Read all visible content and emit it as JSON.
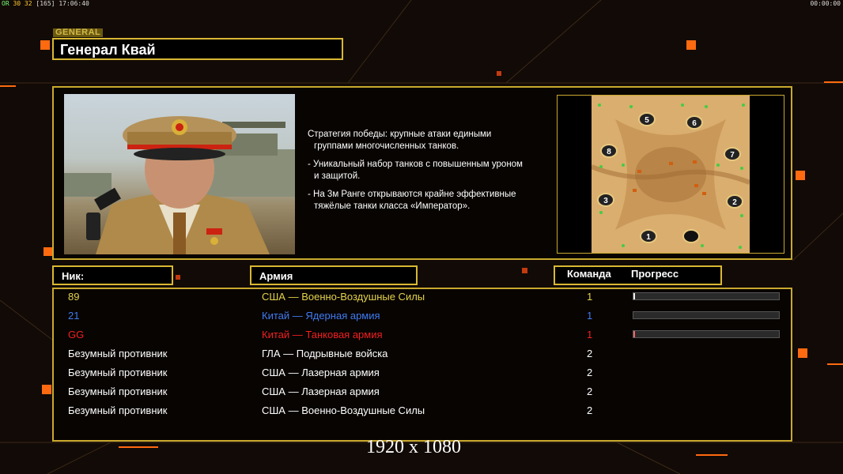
{
  "topbar": {
    "fps_label": "ОR",
    "fps_values": "30 32",
    "fps_extra": "[165]",
    "clock": "17:06:40",
    "timer": "00:00:00"
  },
  "general": {
    "tag": "GENERAL",
    "name": "Генерал Квай"
  },
  "strategy": {
    "lines": [
      [
        "Стратегия победы: крупные атаки едиными",
        " группами многочисленных танков."
      ],
      [
        "- Уникальный набор танков с повышенным уроном",
        "  и защитой."
      ],
      [
        "- На 3м Ранге открываются крайне эффективные",
        "  тяжёлые танки класса «Император»."
      ]
    ]
  },
  "map": {
    "start_positions": [
      "5",
      "6",
      "8",
      "7",
      "3",
      "2",
      "1"
    ]
  },
  "columns": {
    "nick": "Ник:",
    "army": "Армия",
    "team": "Команда",
    "progress": "Прогресс"
  },
  "players": [
    {
      "nick": "89",
      "army": "США — Военно-Воздушные Силы",
      "team": "1",
      "color": "#e3d24a",
      "progress": 0.01
    },
    {
      "nick": "21",
      "army": "Китай — Ядерная армия",
      "team": "1",
      "color": "#3f7bf0",
      "progress": 0.0
    },
    {
      "nick": "GG",
      "army": "Китай — Танковая армия",
      "team": "1",
      "color": "#f02020",
      "progress": 0.01
    },
    {
      "nick": "Безумный противник",
      "army": "ГЛА — Подрывные войска",
      "team": "2",
      "color": "#ffffff"
    },
    {
      "nick": "Безумный противник",
      "army": "США — Лазерная армия",
      "team": "2",
      "color": "#ffffff"
    },
    {
      "nick": "Безумный противник",
      "army": "США — Лазерная армия",
      "team": "2",
      "color": "#ffffff"
    },
    {
      "nick": "Безумный противник",
      "army": "США — Военно-Воздушные Силы",
      "team": "2",
      "color": "#ffffff"
    }
  ],
  "resolution": "1920 x 1080",
  "colors": {
    "accent": "#d9b833",
    "background": "#120a06"
  }
}
